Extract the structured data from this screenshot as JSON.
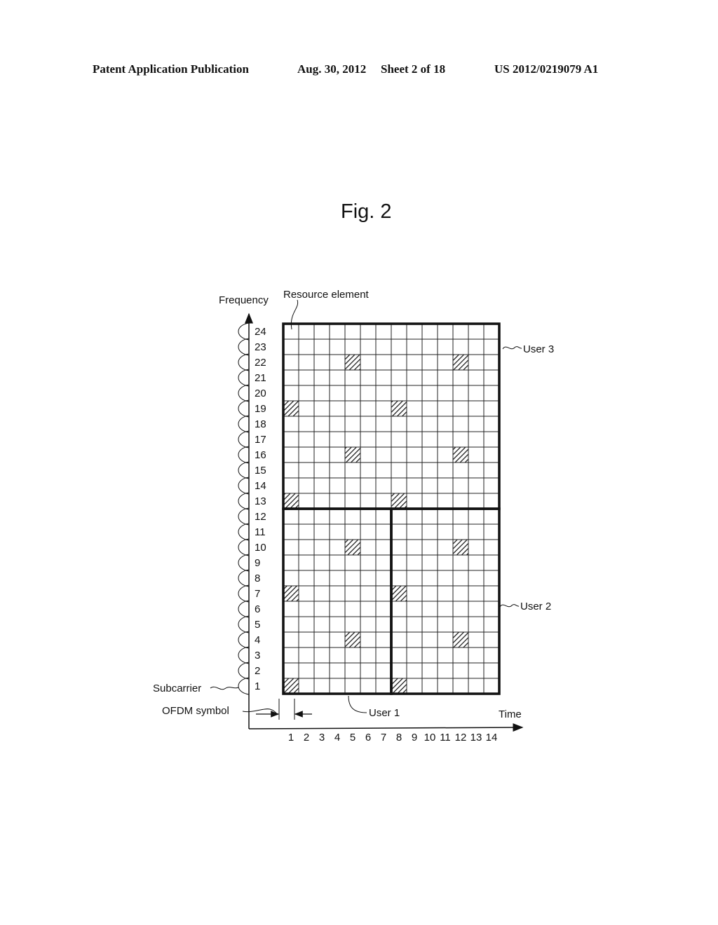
{
  "header": {
    "publication": "Patent Application Publication",
    "date": "Aug. 30, 2012",
    "sheet": "Sheet 2 of 18",
    "number": "US 2012/0219079 A1"
  },
  "figure": {
    "title": "Fig. 2",
    "y_axis_label": "Frequency",
    "x_axis_label": "Time",
    "resource_element_label": "Resource element",
    "subcarrier_label": "Subcarrier",
    "ofdm_symbol_label": "OFDM symbol",
    "users": [
      {
        "label": "User 1",
        "symbols": [
          1,
          7
        ],
        "subcarriers": [
          1,
          12
        ]
      },
      {
        "label": "User 2",
        "symbols": [
          8,
          14
        ],
        "subcarriers": [
          1,
          12
        ]
      },
      {
        "label": "User 3",
        "symbols": [
          1,
          14
        ],
        "subcarriers": [
          13,
          24
        ]
      }
    ],
    "symbol_count": 14,
    "subcarrier_count": 24,
    "symbol_ticks": [
      "1",
      "2",
      "3",
      "4",
      "5",
      "6",
      "7",
      "8",
      "9",
      "10",
      "11",
      "12",
      "13",
      "14"
    ],
    "subcarrier_ticks": [
      "1",
      "2",
      "3",
      "4",
      "5",
      "6",
      "7",
      "8",
      "9",
      "10",
      "11",
      "12",
      "13",
      "14",
      "15",
      "16",
      "17",
      "18",
      "19",
      "20",
      "21",
      "22",
      "23",
      "24"
    ],
    "hatched_cells": [
      {
        "symbol": 1,
        "subcarrier": 1
      },
      {
        "symbol": 8,
        "subcarrier": 1
      },
      {
        "symbol": 5,
        "subcarrier": 4
      },
      {
        "symbol": 12,
        "subcarrier": 4
      },
      {
        "symbol": 1,
        "subcarrier": 7
      },
      {
        "symbol": 8,
        "subcarrier": 7
      },
      {
        "symbol": 5,
        "subcarrier": 10
      },
      {
        "symbol": 12,
        "subcarrier": 10
      },
      {
        "symbol": 1,
        "subcarrier": 13
      },
      {
        "symbol": 8,
        "subcarrier": 13
      },
      {
        "symbol": 5,
        "subcarrier": 16
      },
      {
        "symbol": 12,
        "subcarrier": 16
      },
      {
        "symbol": 1,
        "subcarrier": 19
      },
      {
        "symbol": 8,
        "subcarrier": 19
      },
      {
        "symbol": 5,
        "subcarrier": 22
      },
      {
        "symbol": 12,
        "subcarrier": 22
      }
    ]
  }
}
